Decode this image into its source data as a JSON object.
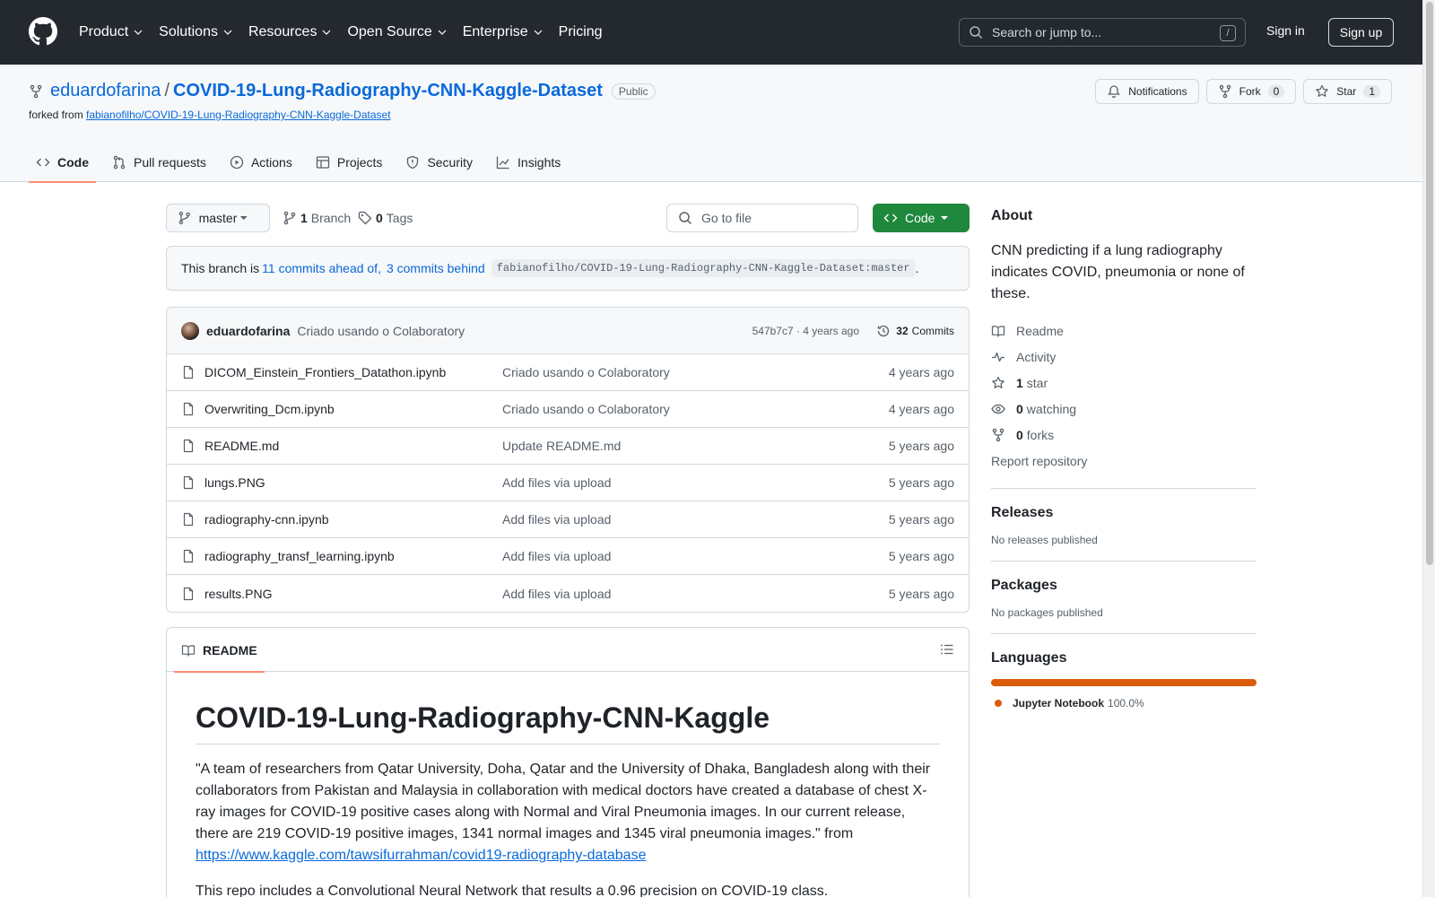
{
  "header": {
    "nav": [
      {
        "label": "Product",
        "dropdown": true
      },
      {
        "label": "Solutions",
        "dropdown": true
      },
      {
        "label": "Resources",
        "dropdown": true
      },
      {
        "label": "Open Source",
        "dropdown": true
      },
      {
        "label": "Enterprise",
        "dropdown": true
      },
      {
        "label": "Pricing",
        "dropdown": false
      }
    ],
    "search_placeholder": "Search or jump to...",
    "search_shortcut": "/",
    "sign_in": "Sign in",
    "sign_up": "Sign up"
  },
  "repo": {
    "owner": "eduardofarina",
    "separator": "/",
    "name": "COVID-19-Lung-Radiography-CNN-Kaggle-Dataset",
    "visibility": "Public",
    "forked_from_label": "forked from",
    "forked_from": "fabianofilho/COVID-19-Lung-Radiography-CNN-Kaggle-Dataset",
    "notifications_label": "Notifications",
    "fork_label": "Fork",
    "fork_count": "0",
    "star_label": "Star",
    "star_count": "1"
  },
  "tabs": [
    {
      "label": "Code",
      "icon": "code-icon",
      "active": true
    },
    {
      "label": "Pull requests",
      "icon": "pull-request-icon"
    },
    {
      "label": "Actions",
      "icon": "play-icon"
    },
    {
      "label": "Projects",
      "icon": "table-icon"
    },
    {
      "label": "Security",
      "icon": "shield-icon"
    },
    {
      "label": "Insights",
      "icon": "graph-icon"
    }
  ],
  "toolbar": {
    "branch": "master",
    "branch_count": "1",
    "branch_label": "Branch",
    "tag_count": "0",
    "tag_label": "Tags",
    "goto_placeholder": "Go to file",
    "code_label": "Code"
  },
  "ahead": {
    "prefix": "This branch is",
    "ahead_text": "11 commits ahead of,",
    "behind_text": "3 commits behind",
    "upstream": "fabianofilho/COVID-19-Lung-Radiography-CNN-Kaggle-Dataset:master",
    "suffix": "."
  },
  "latest_commit": {
    "author": "eduardofarina",
    "message": "Criado usando o Colaboratory",
    "sha_time": "547b7c7 · 4 years ago",
    "count": "32",
    "count_label": "Commits"
  },
  "files": [
    {
      "name": "DICOM_Einstein_Frontiers_Datathon.ipynb",
      "message": "Criado usando o Colaboratory",
      "age": "4 years ago"
    },
    {
      "name": "Overwriting_Dcm.ipynb",
      "message": "Criado usando o Colaboratory",
      "age": "4 years ago"
    },
    {
      "name": "README.md",
      "message": "Update README.md",
      "age": "5 years ago"
    },
    {
      "name": "lungs.PNG",
      "message": "Add files via upload",
      "age": "5 years ago"
    },
    {
      "name": "radiography-cnn.ipynb",
      "message": "Add files via upload",
      "age": "5 years ago"
    },
    {
      "name": "radiography_transf_learning.ipynb",
      "message": "Add files via upload",
      "age": "5 years ago"
    },
    {
      "name": "results.PNG",
      "message": "Add files via upload",
      "age": "5 years ago"
    }
  ],
  "readme": {
    "tab_label": "README",
    "title": "COVID-19-Lung-Radiography-CNN-Kaggle",
    "paragraph1": "\"A team of researchers from Qatar University, Doha, Qatar and the University of Dhaka, Bangladesh along with their collaborators from Pakistan and Malaysia in collaboration with medical doctors have created a database of chest X-ray images for COVID-19 positive cases along with Normal and Viral Pneumonia images. In our current release, there are 219 COVID-19 positive images, 1341 normal images and 1345 viral pneumonia images.\" from",
    "link": "https://www.kaggle.com/tawsifurrahman/covid19-radiography-database",
    "paragraph2": "This repo includes a Convolutional Neural Network that results a 0.96 precision on COVID-19 class."
  },
  "sidebar": {
    "about_title": "About",
    "description": "CNN predicting if a lung radiography indicates COVID, pneumonia or none of these.",
    "readme_label": "Readme",
    "activity_label": "Activity",
    "stars_count": "1",
    "stars_label": "star",
    "watching_count": "0",
    "watching_label": "watching",
    "forks_count": "0",
    "forks_label": "forks",
    "report_label": "Report repository",
    "releases_title": "Releases",
    "releases_text": "No releases published",
    "packages_title": "Packages",
    "packages_text": "No packages published",
    "languages_title": "Languages",
    "language_name": "Jupyter Notebook",
    "language_pct": "100.0%",
    "language_color": "#da5b0b",
    "language_share": 1.0
  }
}
